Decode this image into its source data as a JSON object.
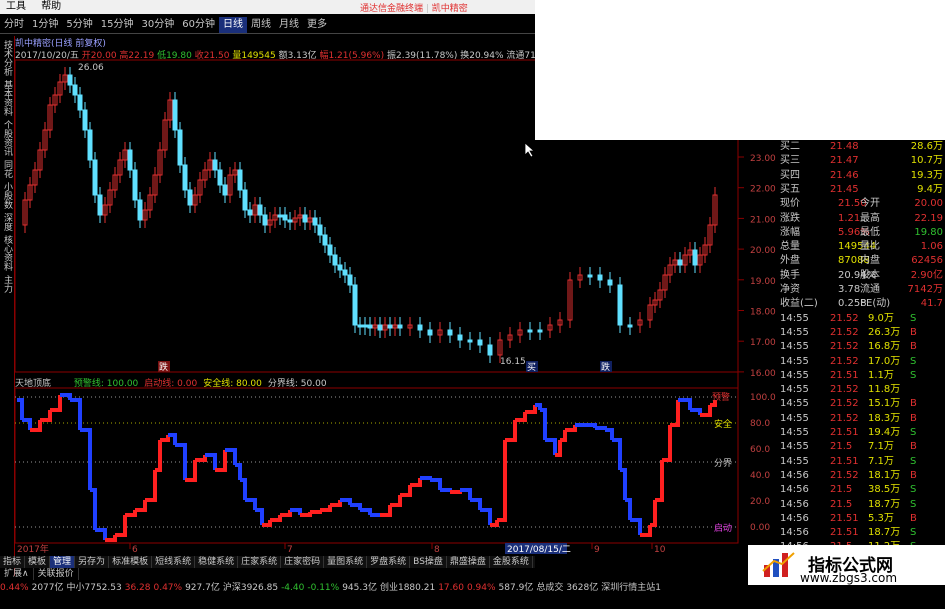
{
  "menu": {
    "items": [
      "工具",
      "帮助"
    ]
  },
  "promo": {
    "left": "通达信金融终端",
    "right": "凯中精密"
  },
  "periods": [
    "分时",
    "1分钟",
    "5分钟",
    "15分钟",
    "30分钟",
    "60分钟",
    "日线",
    "周线",
    "月线",
    "更多"
  ],
  "period_active": "日线",
  "stock": {
    "title": "凯中精密(日线 前复权)",
    "quote_line": [
      {
        "t": "2017/10/20/五 ",
        "c": "#c8c8c8"
      },
      {
        "t": "开20.00 ",
        "c": "#e03030"
      },
      {
        "t": "高22.19 ",
        "c": "#e03030"
      },
      {
        "t": "低19.80 ",
        "c": "#30c030"
      },
      {
        "t": "收21.50 ",
        "c": "#e03030"
      },
      {
        "t": "量149545 ",
        "c": "#e0e000"
      },
      {
        "t": "额3.13亿 ",
        "c": "#c8c8c8"
      },
      {
        "t": "幅1.21(5.96%) ",
        "c": "#e03030"
      },
      {
        "t": "振2.39(11.78%) ",
        "c": "#c8c8c8"
      },
      {
        "t": "换20.94% ",
        "c": "#c8c8c8"
      },
      {
        "t": "流通7142万 ",
        "c": "#c8c8c8"
      },
      {
        "t": "机械基",
        "c": "#c8c8c8"
      }
    ]
  },
  "left_tabs": [
    "技术分析",
    "基本资料",
    "个股资讯",
    "同花",
    "小股数",
    "深度",
    "核心资料",
    "主力"
  ],
  "price_axis": {
    "labels": [
      "23.00",
      "22.00",
      "21.00",
      "20.00",
      "19.00",
      "18.00",
      "17.00",
      "16.00"
    ]
  },
  "osc_axis": {
    "labels": [
      "100.0",
      "80.0",
      "60.0",
      "40.0",
      "20.0",
      "0.00"
    ]
  },
  "annotations": {
    "high": "26.06",
    "low": "16.15",
    "mark1": "跌",
    "mark2": "买",
    "mark3": "跌"
  },
  "osc": {
    "title": "天地顶底",
    "items": [
      {
        "t": "预警线: 100.00",
        "c": "#30c030"
      },
      {
        "t": "启动线: 0.00",
        "c": "#e03030"
      },
      {
        "t": "安全线: 80.00",
        "c": "#e0e000"
      },
      {
        "t": "分界线: 50.00",
        "c": "#c8c8c8"
      }
    ],
    "labels": {
      "warn": "预警",
      "safe": "安全",
      "split": "分界",
      "start": "启动"
    }
  },
  "xaxis": {
    "labels": [
      "2017年",
      "6",
      "7",
      "8",
      "9",
      "10"
    ],
    "highlight": "2017/08/15/二"
  },
  "order_book": {
    "asks": [
      {
        "label": "买二",
        "price": "21.48",
        "vol": "28.6万"
      },
      {
        "label": "买三",
        "price": "21.47",
        "vol": "10.7万"
      },
      {
        "label": "买四",
        "price": "21.46",
        "vol": "19.3万"
      },
      {
        "label": "买五",
        "price": "21.45",
        "vol": "9.4万"
      }
    ],
    "stats": [
      {
        "l1": "现价",
        "v1": "21.50",
        "l2": "今开",
        "v2": "20.00"
      },
      {
        "l1": "涨跌",
        "v1": "1.21",
        "l2": "最高",
        "v2": "22.19"
      },
      {
        "l1": "涨幅",
        "v1": "5.96%",
        "l2": "最低",
        "v2": "19.80"
      },
      {
        "l1": "总量",
        "v1": "149544",
        "l2": "量比",
        "v2": "1.06"
      },
      {
        "l1": "外盘",
        "v1": "87088",
        "l2": "内盘",
        "v2": "62456"
      },
      {
        "l1": "换手",
        "v1": "20.94%",
        "l2": "股本",
        "v2": "2.90亿"
      },
      {
        "l1": "净资",
        "v1": "3.78",
        "l2": "流通",
        "v2": "7142万"
      },
      {
        "l1": "收益(二)",
        "v1": "0.258",
        "l2": "PE(动)",
        "v2": "41.7"
      }
    ],
    "trades": [
      {
        "time": "14:55",
        "price": "21.52",
        "vol": "9.0万",
        "bs": "S"
      },
      {
        "time": "14:55",
        "price": "21.52",
        "vol": "26.3万",
        "bs": "B"
      },
      {
        "time": "14:55",
        "price": "21.52",
        "vol": "16.8万",
        "bs": "B"
      },
      {
        "time": "14:55",
        "price": "21.52",
        "vol": "17.0万",
        "bs": "S"
      },
      {
        "time": "14:55",
        "price": "21.51",
        "vol": "1.1万",
        "bs": "S"
      },
      {
        "time": "14:55",
        "price": "21.52",
        "vol": "11.8万",
        "bs": ""
      },
      {
        "time": "14:55",
        "price": "21.52",
        "vol": "15.1万",
        "bs": "B"
      },
      {
        "time": "14:55",
        "price": "21.52",
        "vol": "18.3万",
        "bs": "B"
      },
      {
        "time": "14:55",
        "price": "21.51",
        "vol": "19.4万",
        "bs": "S"
      },
      {
        "time": "14:55",
        "price": "21.5",
        "vol": "7.1万",
        "bs": "B"
      },
      {
        "time": "14:55",
        "price": "21.51",
        "vol": "7.1万",
        "bs": "S"
      },
      {
        "time": "14:56",
        "price": "21.52",
        "vol": "18.1万",
        "bs": "B"
      },
      {
        "time": "14:56",
        "price": "21.5",
        "vol": "38.5万",
        "bs": "S"
      },
      {
        "time": "14:56",
        "price": "21.5",
        "vol": "18.7万",
        "bs": "S"
      },
      {
        "time": "14:56",
        "price": "21.51",
        "vol": "5.3万",
        "bs": "B"
      },
      {
        "time": "14:56",
        "price": "21.51",
        "vol": "18.7万",
        "bs": "S"
      },
      {
        "time": "14:56",
        "price": "21.5",
        "vol": "11.2万",
        "bs": "S"
      },
      {
        "time": "14:56",
        "price": "21.5",
        "vol": "21.3万",
        "bs": "S"
      },
      {
        "time": "14:56",
        "price": "21.5",
        "vol": "0.5万",
        "bs": "B"
      }
    ]
  },
  "bottom_tabs": [
    "指标",
    "模板",
    "管理",
    "另存为",
    "标准模板",
    "短线系统",
    "稳健系统",
    "庄家系统",
    "庄家密码",
    "量图系统",
    "罗盘系统",
    "BS操盘",
    "鼎盛操盘",
    "金股系统"
  ],
  "bottom_tab_active": "管理",
  "sub_tabs": [
    "扩展∧",
    "关联报价"
  ],
  "ticker": [
    {
      "t": "0.44%",
      "c": "#e03030"
    },
    {
      "t": "2077亿",
      "c": "#c8c8c8"
    },
    {
      "t": "中小7752.53",
      "c": "#c8c8c8"
    },
    {
      "t": "36.28",
      "c": "#e03030"
    },
    {
      "t": "0.47%",
      "c": "#e03030"
    },
    {
      "t": "927.7亿",
      "c": "#c8c8c8"
    },
    {
      "t": "沪深3926.85",
      "c": "#c8c8c8"
    },
    {
      "t": "-4.40",
      "c": "#30c030"
    },
    {
      "t": "-0.11%",
      "c": "#30c030"
    },
    {
      "t": "945.3亿",
      "c": "#c8c8c8"
    },
    {
      "t": "创业1880.21",
      "c": "#c8c8c8"
    },
    {
      "t": "17.60",
      "c": "#e03030"
    },
    {
      "t": "0.94%",
      "c": "#e03030"
    },
    {
      "t": "587.9亿",
      "c": "#c8c8c8"
    },
    {
      "t": "总成交",
      "c": "#c8c8c8"
    },
    {
      "t": "3628亿",
      "c": "#c8c8c8"
    },
    {
      "t": "深圳行情主站1",
      "c": "#c8c8c8"
    }
  ],
  "brand": {
    "title": "指标公式网",
    "url": "www.zbgs3.com"
  },
  "colors": {
    "up": "#e03030",
    "down": "#60e0ff",
    "osc_up": "#ff2020",
    "osc_down": "#2040ff",
    "grid": "#8b0000"
  }
}
